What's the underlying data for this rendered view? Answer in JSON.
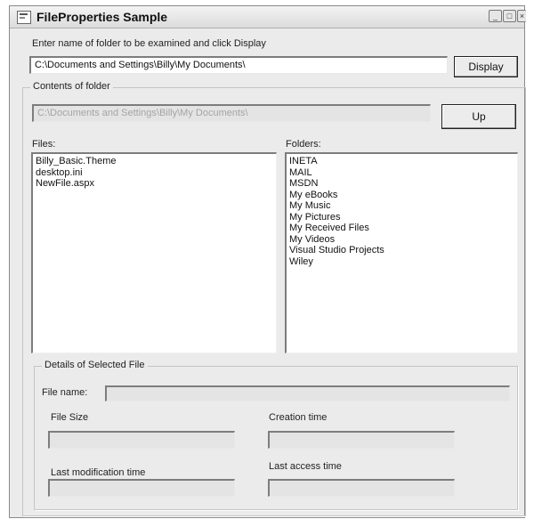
{
  "window": {
    "title": "FileProperties Sample"
  },
  "folder_prompt": "Enter name of folder to be examined and click Display",
  "folder_path_value": "C:\\Documents and Settings\\Billy\\My Documents\\",
  "display_button": "Display",
  "contents_group": {
    "title": "Contents of folder",
    "current_path": "C:\\Documents and Settings\\Billy\\My Documents\\",
    "up_button": "Up",
    "files_label": "Files:",
    "folders_label": "Folders:",
    "files": [
      "Billy_Basic.Theme",
      "desktop.ini",
      "NewFile.aspx"
    ],
    "folders": [
      "INETA",
      "MAIL",
      "MSDN",
      "My eBooks",
      "My Music",
      "My Pictures",
      "My Received Files",
      "My Videos",
      "Visual Studio Projects",
      "Wiley"
    ]
  },
  "details_group": {
    "title": "Details of Selected File",
    "file_name_label": "File name:",
    "file_size_label": "File Size",
    "creation_time_label": "Creation time",
    "last_modification_label": "Last modification time",
    "last_access_label": "Last access time",
    "file_name_value": "",
    "file_size_value": "",
    "creation_time_value": "",
    "last_modification_value": "",
    "last_access_value": ""
  }
}
